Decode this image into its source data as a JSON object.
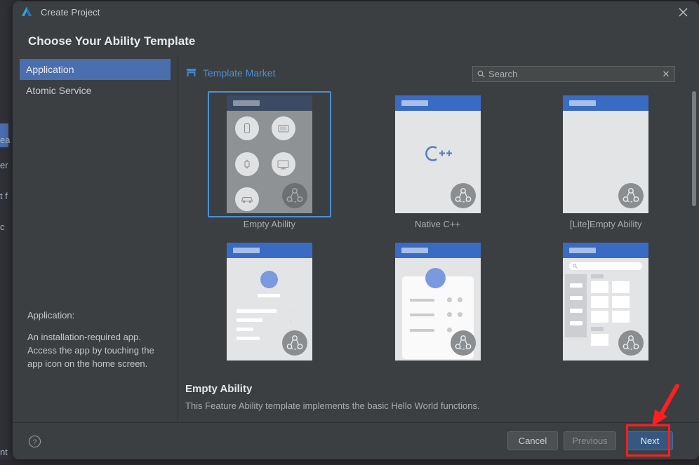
{
  "window": {
    "title": "Create Project",
    "logo_icon": "deveco-logo-icon",
    "close_icon": "close-icon"
  },
  "heading": "Choose Your Ability Template",
  "left_pane": {
    "categories": [
      {
        "label": "Application",
        "selected": true
      },
      {
        "label": "Atomic Service",
        "selected": false
      }
    ],
    "description": {
      "title": "Application:",
      "body": "An installation-required app. Access the app by touching the app icon on the home screen."
    }
  },
  "market": {
    "icon": "store-icon",
    "label": "Template Market"
  },
  "search": {
    "icon": "search-icon",
    "value": "",
    "placeholder": "Search",
    "clear_icon": "clear-icon",
    "clear_glyph": "✕"
  },
  "templates": [
    {
      "name": "Empty Ability",
      "selected": true,
      "kind": "devices"
    },
    {
      "name": "Native C++",
      "selected": false,
      "kind": "cpp"
    },
    {
      "name": "[Lite]Empty Ability",
      "selected": false,
      "kind": "blank"
    },
    {
      "name": "",
      "selected": false,
      "kind": "profile"
    },
    {
      "name": "",
      "selected": false,
      "kind": "card-list"
    },
    {
      "name": "",
      "selected": false,
      "kind": "grid"
    }
  ],
  "selection": {
    "title": "Empty Ability",
    "subtitle": "This Feature Ability template implements the basic Hello World functions."
  },
  "scrollbar": {
    "name": "template-grid-scrollbar"
  },
  "footer": {
    "help_icon": "help-icon",
    "help_glyph": "?",
    "cancel_label": "Cancel",
    "previous_label": "Previous",
    "next_label": "Next"
  },
  "annotation": {
    "highlight_target": "Next",
    "color": "#ff1f1f",
    "arrow": "red-arrow-annotation",
    "rect": "red-highlight-rectangle"
  },
  "background_fragments": [
    "ea",
    "er",
    "t f",
    "c",
    "nt"
  ],
  "colors": {
    "dialog_bg": "#3c3f41",
    "accent_blue": "#4a90d9",
    "selection_blue": "#4b6eaf",
    "next_button": "#365880",
    "annotation_red": "#ff1f1f"
  }
}
